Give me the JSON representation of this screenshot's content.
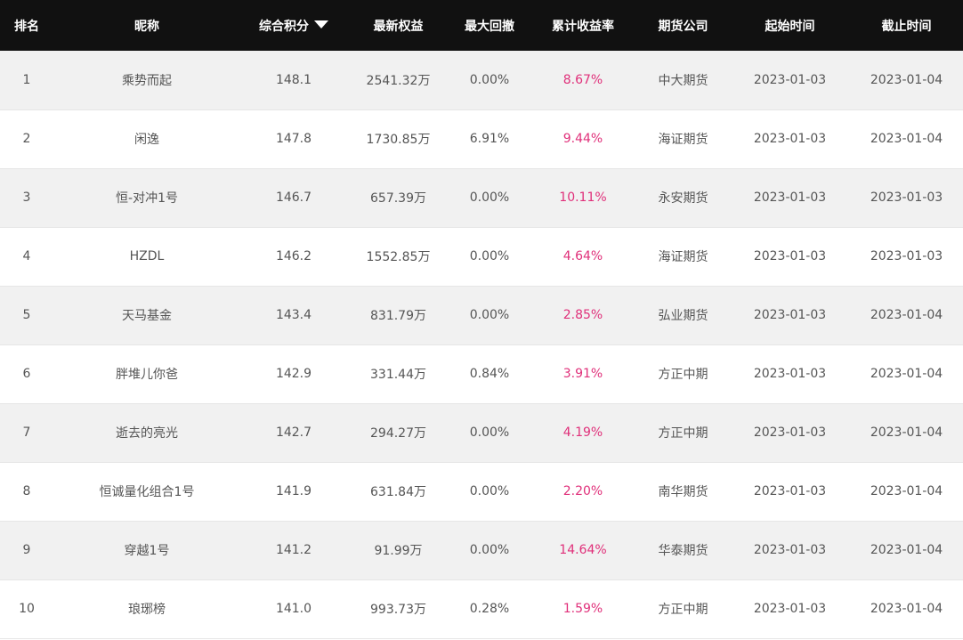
{
  "colors": {
    "header_bg": "#111111",
    "header_text": "#ffffff",
    "row_alt_bg": "#f1f1f1",
    "text": "#555555",
    "return_color": "#e0307a"
  },
  "header": {
    "rank": "排名",
    "nickname": "昵称",
    "score": "综合积分",
    "score_sort_icon": "caret-down-icon",
    "equity": "最新权益",
    "drawdown": "最大回撤",
    "return": "累计收益率",
    "company": "期货公司",
    "start": "起始时间",
    "end": "截止时间"
  },
  "rows": [
    {
      "rank": "1",
      "nickname": "乘势而起",
      "score": "148.1",
      "equity": "2541.32万",
      "drawdown": "0.00%",
      "return": "8.67%",
      "company": "中大期货",
      "start": "2023-01-03",
      "end": "2023-01-04"
    },
    {
      "rank": "2",
      "nickname": "闲逸",
      "score": "147.8",
      "equity": "1730.85万",
      "drawdown": "6.91%",
      "return": "9.44%",
      "company": "海证期货",
      "start": "2023-01-03",
      "end": "2023-01-04"
    },
    {
      "rank": "3",
      "nickname": "恒-对冲1号",
      "score": "146.7",
      "equity": "657.39万",
      "drawdown": "0.00%",
      "return": "10.11%",
      "company": "永安期货",
      "start": "2023-01-03",
      "end": "2023-01-03"
    },
    {
      "rank": "4",
      "nickname": "HZDL",
      "score": "146.2",
      "equity": "1552.85万",
      "drawdown": "0.00%",
      "return": "4.64%",
      "company": "海证期货",
      "start": "2023-01-03",
      "end": "2023-01-03"
    },
    {
      "rank": "5",
      "nickname": "天马基金",
      "score": "143.4",
      "equity": "831.79万",
      "drawdown": "0.00%",
      "return": "2.85%",
      "company": "弘业期货",
      "start": "2023-01-03",
      "end": "2023-01-04"
    },
    {
      "rank": "6",
      "nickname": "胖堆儿你爸",
      "score": "142.9",
      "equity": "331.44万",
      "drawdown": "0.84%",
      "return": "3.91%",
      "company": "方正中期",
      "start": "2023-01-03",
      "end": "2023-01-04"
    },
    {
      "rank": "7",
      "nickname": "逝去的亮光",
      "score": "142.7",
      "equity": "294.27万",
      "drawdown": "0.00%",
      "return": "4.19%",
      "company": "方正中期",
      "start": "2023-01-03",
      "end": "2023-01-04"
    },
    {
      "rank": "8",
      "nickname": "恒诚量化组合1号",
      "score": "141.9",
      "equity": "631.84万",
      "drawdown": "0.00%",
      "return": "2.20%",
      "company": "南华期货",
      "start": "2023-01-03",
      "end": "2023-01-04"
    },
    {
      "rank": "9",
      "nickname": "穿越1号",
      "score": "141.2",
      "equity": "91.99万",
      "drawdown": "0.00%",
      "return": "14.64%",
      "company": "华泰期货",
      "start": "2023-01-03",
      "end": "2023-01-04"
    },
    {
      "rank": "10",
      "nickname": "琅琊榜",
      "score": "141.0",
      "equity": "993.73万",
      "drawdown": "0.28%",
      "return": "1.59%",
      "company": "方正中期",
      "start": "2023-01-03",
      "end": "2023-01-04"
    }
  ]
}
